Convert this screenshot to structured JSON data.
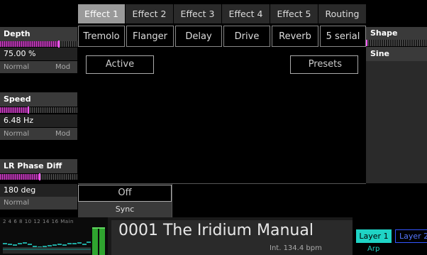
{
  "tabs": [
    "Effect 1",
    "Effect 2",
    "Effect 3",
    "Effect 4",
    "Effect 5",
    "Routing"
  ],
  "active_tab": "Effect 1",
  "effect_types": [
    "Tremolo",
    "Flanger",
    "Delay",
    "Drive",
    "Reverb",
    "5 serial"
  ],
  "buttons": {
    "active": "Active",
    "presets": "Presets",
    "off": "Off",
    "sync": "Sync"
  },
  "params": {
    "depth": {
      "label": "Depth",
      "value": "75.00 %",
      "mode1": "Normal",
      "mode2": "Mod",
      "level": 0.75
    },
    "speed": {
      "label": "Speed",
      "value": "6.48 Hz",
      "mode1": "Normal",
      "mode2": "Mod",
      "level": 0.36
    },
    "phase": {
      "label": "LR Phase Diff",
      "value": "180 deg",
      "mode1": "Normal",
      "level": 0.5
    },
    "shape": {
      "label": "Shape",
      "value": "Sine",
      "level": 0.02
    }
  },
  "footer": {
    "level_scale": "2 4 6 8 10 12 14 16 Main",
    "preset_title": "0001 The Iridium Manual",
    "tempo": "Int. 134.4 bpm",
    "layer1": "Layer 1",
    "layer2": "Layer 2",
    "arp": "Arp"
  },
  "colors": {
    "accent": "#1fd3c5",
    "meter": "#d23ec8",
    "tab_active": "#9a9a9a"
  }
}
